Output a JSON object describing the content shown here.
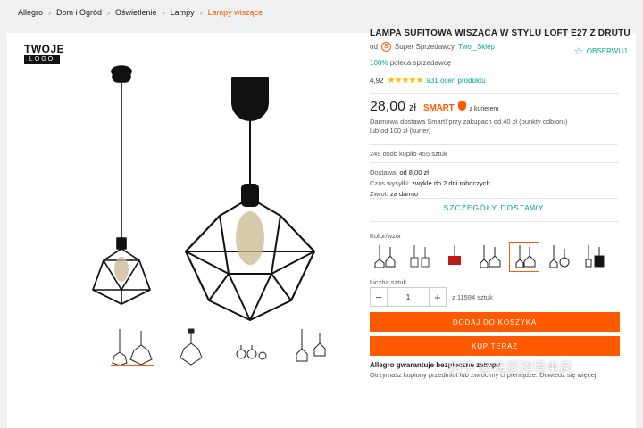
{
  "breadcrumb": [
    "Allegro",
    "Dom i Ogród",
    "Oświetlenie",
    "Lampy",
    "Lampy wiszące"
  ],
  "brand": {
    "top": "TWOJE",
    "bottom": "LOGO"
  },
  "observe_label": "OBSERWUJ",
  "product": {
    "title": "LAMPA SUFITOWA WISZĄCA W STYLU LOFT E27 Z DRUTU",
    "seller_prefix": "od",
    "seller_badge_icon": "super-seller-icon",
    "seller_badge_label": "Super Sprzedawcy",
    "seller_name": "Twoj_Sklep",
    "recommend_pct": "100%",
    "recommend_text": "poleca sprzedawcę",
    "rating_value": "4,92",
    "rating_count": "931 ocen produktu",
    "price": "28,00",
    "currency": "zł",
    "smart_label": "SMART",
    "smart_suffix": "z kurierem",
    "delivery_note": "Darmowa dostawa Smart! przy zakupach od 40 zł (punkty odbioru) lub od 100 zł (kurier)",
    "bought": "249 osób kupiło 455 sztuk",
    "shipping": {
      "cost_label": "Dostawa:",
      "cost_value": "od 8,00 zł",
      "time_label": "Czas wysyłki:",
      "time_value": "zwykle do 2 dni roboczych",
      "return_label": "Zwrot:",
      "return_value": "za darmo"
    },
    "details_link": "SZCZEGÓŁY DOSTAWY",
    "color_label": "Kolor/wzór",
    "qty_label": "Liczba sztuk",
    "qty_value": "1",
    "qty_max": "z 11594 sztuk",
    "add_to_cart": "DODAJ DO KOSZYKA",
    "buy_now": "KUP TERAZ",
    "guarantee_title": "Allegro gwarantuje bezpieczne zakupy",
    "guarantee_text": "Otrzymasz kupiony przedmiot lub zwrócimy ci pieniądze. Dowiedz się więcej"
  },
  "watermark": "知乎 @海豪跨境电商",
  "colors": {
    "accent": "#ff5a00",
    "teal": "#00a790"
  }
}
